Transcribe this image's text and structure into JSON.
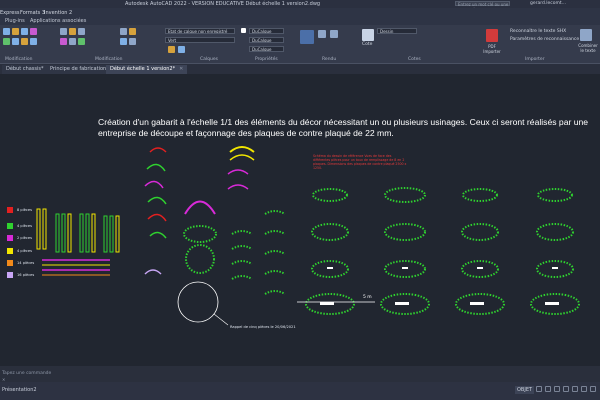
{
  "window": {
    "title": "Autodesk AutoCAD 2022 - VERSION EDUCATIVE     Début échelle 1 version2.dwg",
    "search_placeholder": "Entrez un mot clé ou une expression",
    "user": "gerard.lecomt..."
  },
  "menubar": {
    "items": [
      "Express",
      "Formats 3",
      "Invention 2"
    ]
  },
  "ribbon_tabs": {
    "items": [
      "Plug-ins",
      "Applications associées"
    ]
  },
  "ribbon": {
    "panels": [
      "Modification",
      "Modification",
      "Calques",
      "Propriétés",
      "Rendu",
      "Cotes",
      "Importer"
    ],
    "layer_state": "Etat de calque non enregistré",
    "layer_current": "Vert",
    "bylayer": "DuCalque",
    "bylayer2": "DuCalque",
    "bylayer3": "DuCalque",
    "style_current": "Dessin",
    "annotation": "Général",
    "tool_cote": "Cote",
    "pdf_import_label": "PDF Importer",
    "recognize_shx": "Reconnaître le texte SHX",
    "recognize_settings": "Paramètres de reconnaissance",
    "combine_text": "Combiner le texte",
    "share_label": "Partager"
  },
  "doc_tabs": {
    "items": [
      "Début chassis*",
      "Principe de fabrication*",
      "Début échelle 1 version2*"
    ],
    "active_index": 2
  },
  "drawing": {
    "note": "Création d'un gabarit à l'échelle 1/1 des éléments du décor  nécessitant un ou  plusieurs usinages. Ceux ci seront réalisés par une entreprise de découpe et façonnage des plaques de contre plaqué de 22 mm.",
    "legend": [
      {
        "label": "8 pièces",
        "color": "#e32020"
      },
      {
        "label": "4 pièces",
        "color": "#2fd12f"
      },
      {
        "label": "2 pièces",
        "color": "#d82ad8"
      },
      {
        "label": "4 pièces",
        "color": "#f2e600"
      },
      {
        "label": "14 pièces",
        "color": "#f28a1a"
      },
      {
        "label": "16 pièces",
        "color": "#c8a6f5"
      }
    ],
    "red_note": "Schéma du dessin de référence Vues de face des différentes pièces pour un taux de remplissage de 8 en 2 plaques. Dimensions des plaques de contre plaqué 2500 x 1250.",
    "detail_label": "Rappel de cinq pièces le 20/06/2021",
    "scale_label": "5 m",
    "colors": {
      "green": "#2fd12f",
      "magenta": "#d82ad8",
      "yellow": "#f2e600",
      "white": "#ffffff",
      "red": "#e32020"
    }
  },
  "command_line": {
    "placeholder": "Tapez une commande",
    "cross": "✕"
  },
  "statusbar": {
    "layout_tab": "Présentation2",
    "ortho_label": "OBJET"
  }
}
